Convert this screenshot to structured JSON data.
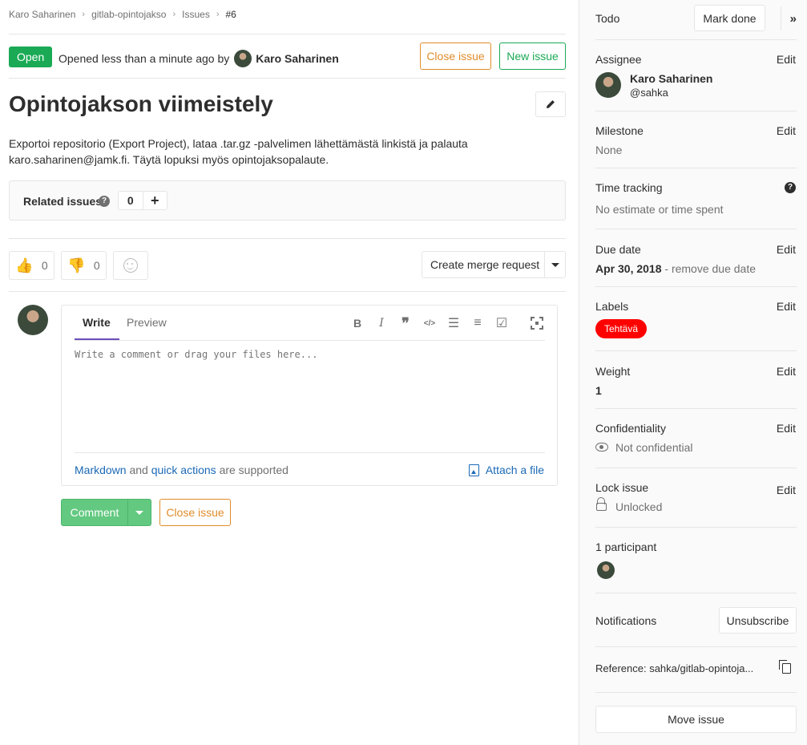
{
  "breadcrumb": {
    "items": [
      "Karo Saharinen",
      "gitlab-opintojakso",
      "Issues",
      "#6"
    ],
    "separator": "›"
  },
  "issue": {
    "status": "Open",
    "opened_text": "Opened less than a minute ago by",
    "author": "Karo Saharinen",
    "close_label": "Close issue",
    "new_label": "New issue",
    "title": "Opintojakson viimeistely",
    "description": "Exportoi repositorio (Export Project), lataa .tar.gz -palvelimen lähettämästä linkistä ja palauta karo.saharinen@jamk.fi. Täytä lopuksi myös opintojaksopalaute."
  },
  "related": {
    "label": "Related issues",
    "count": "0",
    "add": "+"
  },
  "awards": {
    "thumbs_up": "0",
    "thumbs_down": "0",
    "thumbs_up_icon": "👍",
    "thumbs_down_icon": "👎"
  },
  "merge_request": {
    "label": "Create merge request"
  },
  "comment": {
    "tab_write": "Write",
    "tab_preview": "Preview",
    "placeholder": "Write a comment or drag your files here...",
    "markdown": "Markdown",
    "and": "and",
    "quick_actions": "quick actions",
    "supported": "are supported",
    "attach": "Attach a file",
    "submit": "Comment",
    "close": "Close issue",
    "toolbar": [
      "B",
      "I",
      "❞",
      "</>",
      "☰",
      "≡",
      "☑"
    ]
  },
  "sidebar": {
    "todo": {
      "title": "Todo",
      "button": "Mark done",
      "collapse": "»"
    },
    "assignee": {
      "title": "Assignee",
      "edit": "Edit",
      "name": "Karo Saharinen",
      "username": "@sahka"
    },
    "milestone": {
      "title": "Milestone",
      "edit": "Edit",
      "value": "None"
    },
    "time_tracking": {
      "title": "Time tracking",
      "value": "No estimate or time spent",
      "help": "?"
    },
    "due_date": {
      "title": "Due date",
      "edit": "Edit",
      "date": "Apr 30, 2018",
      "remove": " - remove due date"
    },
    "labels": {
      "title": "Labels",
      "edit": "Edit",
      "items": [
        "Tehtävä"
      ],
      "color": "#ff0000"
    },
    "weight": {
      "title": "Weight",
      "edit": "Edit",
      "value": "1"
    },
    "confidentiality": {
      "title": "Confidentiality",
      "edit": "Edit",
      "value": "Not confidential"
    },
    "lock": {
      "title": "Lock issue",
      "edit": "Edit",
      "value": "Unlocked"
    },
    "participants": {
      "title": "1 participant"
    },
    "notifications": {
      "title": "Notifications",
      "button": "Unsubscribe"
    },
    "reference": {
      "text": "Reference: sahka/gitlab-opintoja..."
    },
    "move": {
      "button": "Move issue"
    }
  },
  "colors": {
    "open": "#1aaa55",
    "warning": "#e08c2c",
    "link": "#1b69b6",
    "comment": "#63c981"
  }
}
